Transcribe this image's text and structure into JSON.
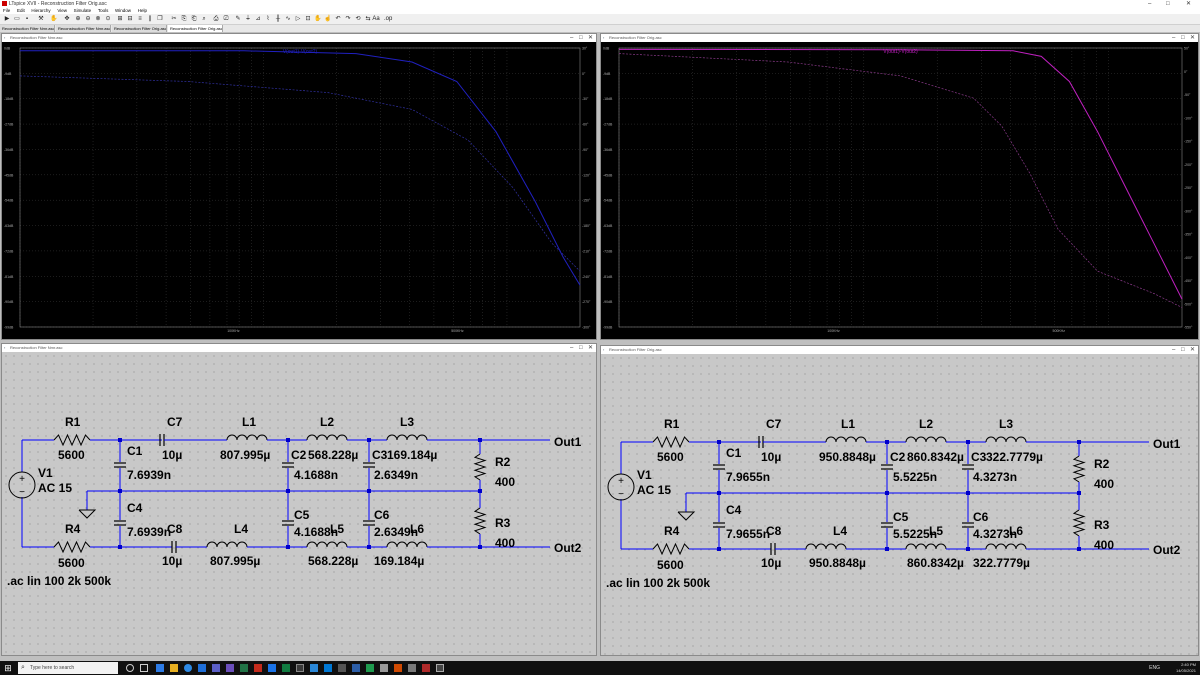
{
  "window": {
    "title": "LTspice XVII - Reconstruction Filter Orig.asc",
    "minimize": "–",
    "maximize": "□",
    "close": "✕"
  },
  "menu": [
    "File",
    "Edit",
    "Hierarchy",
    "View",
    "Simulate",
    "Tools",
    "Window",
    "Help"
  ],
  "tabs": [
    "Reconstruction Filter Nmr.asc",
    "Reconstruction Filter Nmr.asc",
    "Reconstruction Filter Orig.asc",
    "Reconstruction Filter Orig.asc"
  ],
  "plot_left": {
    "title": "Reconstruction Filter Nmr.asc",
    "trace": "V(out1)-V(out2)",
    "trace_color": "#2020c0",
    "y_left": [
      "0dB",
      "-9dB",
      "-18dB",
      "-27dB",
      "-36dB",
      "-45dB",
      "-54dB",
      "-63dB",
      "-72dB",
      "-81dB",
      "-90dB",
      "-99dB"
    ],
    "y_right": [
      "30°",
      "0°",
      "-30°",
      "-60°",
      "-90°",
      "-120°",
      "-150°",
      "-180°",
      "-210°",
      "-240°",
      "-270°",
      "-300°"
    ],
    "x_ticks": [
      "100KHz",
      "500KHz"
    ]
  },
  "plot_right": {
    "title": "Reconstruction Filter Orig.asc",
    "trace": "V(out1)-V(out2)",
    "trace_color": "#c020c0",
    "y_left": [
      "0dB",
      "-9dB",
      "-18dB",
      "-27dB",
      "-36dB",
      "-45dB",
      "-54dB",
      "-63dB",
      "-72dB",
      "-81dB",
      "-90dB",
      "-99dB"
    ],
    "y_right": [
      "50°",
      "0°",
      "-50°",
      "-100°",
      "-150°",
      "-200°",
      "-250°",
      "-300°",
      "-350°",
      "-400°",
      "-450°",
      "-500°",
      "-550°"
    ],
    "x_ticks": [
      "100KHz",
      "500KHz"
    ]
  },
  "schem_left": {
    "title": "Reconstruction Filter Nmr.asc",
    "R1": {
      "name": "R1",
      "value": "5600"
    },
    "V1": {
      "name": "V1",
      "value": "AC 15"
    },
    "R4": {
      "name": "R4",
      "value": "5600"
    },
    "C7": {
      "name": "C7",
      "value": "10µ"
    },
    "C8": {
      "name": "C8",
      "value": "10µ"
    },
    "C1": {
      "name": "C1",
      "value": "7.6939n"
    },
    "C4": {
      "name": "C4",
      "value": "7.6939n"
    },
    "L1": {
      "name": "L1",
      "value": "807.995µ"
    },
    "L4": {
      "name": "L4",
      "value": "807.995µ"
    },
    "L2": {
      "name": "L2",
      "value": "568.228µ"
    },
    "L5": {
      "name": "L5",
      "value": "568.228µ"
    },
    "C2": {
      "name": "C2",
      "value": "4.1688n"
    },
    "C5": {
      "name": "C5",
      "value": "4.1688n"
    },
    "L3": {
      "name": "L3",
      "value": "169.184µ"
    },
    "L6": {
      "name": "L6",
      "value": "169.184µ"
    },
    "C3": {
      "name": "C3",
      "value": "2.6349n"
    },
    "C6": {
      "name": "C6",
      "value": "2.6349n"
    },
    "R2": {
      "name": "R2",
      "value": "400"
    },
    "R3": {
      "name": "R3",
      "value": "400"
    },
    "out1": "Out1",
    "out2": "Out2",
    "directive": ".ac lin 100 2k 500k"
  },
  "schem_right": {
    "title": "Reconstruction Filter Orig.asc",
    "R1": {
      "name": "R1",
      "value": "5600"
    },
    "V1": {
      "name": "V1",
      "value": "AC 15"
    },
    "R4": {
      "name": "R4",
      "value": "5600"
    },
    "C7": {
      "name": "C7",
      "value": "10µ"
    },
    "C8": {
      "name": "C8",
      "value": "10µ"
    },
    "C1": {
      "name": "C1",
      "value": "7.9655n"
    },
    "C4": {
      "name": "C4",
      "value": "7.9655n"
    },
    "L1": {
      "name": "L1",
      "value": "950.8848µ"
    },
    "L4": {
      "name": "L4",
      "value": "950.8848µ"
    },
    "L2": {
      "name": "L2",
      "value": "860.8342µ"
    },
    "L5": {
      "name": "L5",
      "value": "860.8342µ"
    },
    "C2": {
      "name": "C2",
      "value": "5.5225n"
    },
    "C5": {
      "name": "C5",
      "value": "5.5225n"
    },
    "L3": {
      "name": "L3",
      "value": "322.7779µ"
    },
    "L6": {
      "name": "L6",
      "value": "322.7779µ"
    },
    "C3": {
      "name": "C3",
      "value": "4.3273n"
    },
    "C6": {
      "name": "C6",
      "value": "4.3273n"
    },
    "R2": {
      "name": "R2",
      "value": "400"
    },
    "R3": {
      "name": "R3",
      "value": "400"
    },
    "out1": "Out1",
    "out2": "Out2",
    "directive": ".ac lin 100 2k 500k"
  },
  "taskbar": {
    "search_placeholder": "Type here to search",
    "time": "2:40 PM",
    "date": "14/05/2021",
    "lang": "ENG"
  }
}
